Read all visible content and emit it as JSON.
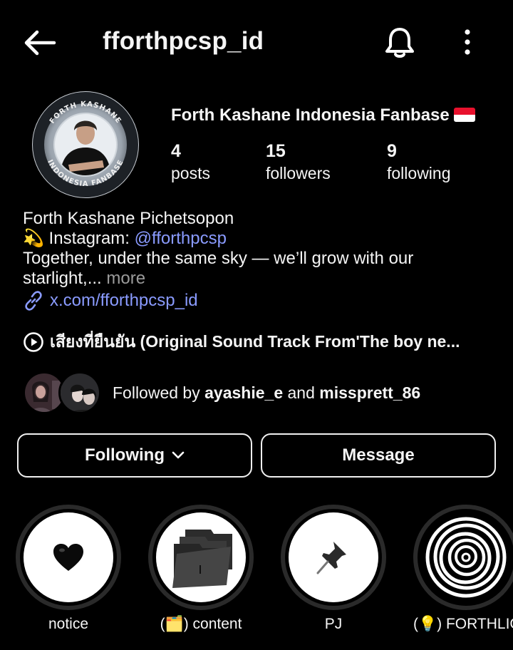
{
  "header": {
    "username": "fforthpcsp_id",
    "back_icon": "back-arrow-icon",
    "bell_icon": "bell-icon",
    "more_icon": "more-vertical-icon"
  },
  "profile": {
    "display_name": "Forth Kashane Indonesia Fanbase",
    "avatar_ring_text_top": "FORTH KASHANE",
    "avatar_ring_text_bottom": "INDONESIA FANBASE",
    "stats": {
      "posts": {
        "value": "4",
        "label": "posts"
      },
      "followers": {
        "value": "15",
        "label": "followers"
      },
      "following": {
        "value": "9",
        "label": "following"
      }
    }
  },
  "bio": {
    "line1": "Forth Kashane Pichetsopon",
    "line2_prefix": "💫 Instagram: ",
    "line2_handle": "@fforthpcsp",
    "line3": "Together, under the same sky — we’ll grow with our",
    "line4": "starlight,...",
    "more": "more",
    "link": "x.com/fforthpcsp_id"
  },
  "music": {
    "title": "เสียงที่ยืนยัน (Original Sound Track From'The boy ne..."
  },
  "followed_by": {
    "prefix": "Followed by ",
    "user1": "ayashie_e",
    "conjunction": " and ",
    "user2": "missprett_86"
  },
  "buttons": {
    "following": "Following",
    "message": "Message"
  },
  "highlights": [
    {
      "label": "notice",
      "icon": "black-heart-icon"
    },
    {
      "label": "(🗂️) content",
      "icon": "folder-icon"
    },
    {
      "label": "PJ",
      "icon": "pushpin-icon"
    },
    {
      "label": "(💡) FORTHLIG",
      "icon": "spiral-icon"
    }
  ],
  "colors": {
    "background": "#000000",
    "link": "#8a9bff",
    "muted": "#9b9b9b"
  }
}
